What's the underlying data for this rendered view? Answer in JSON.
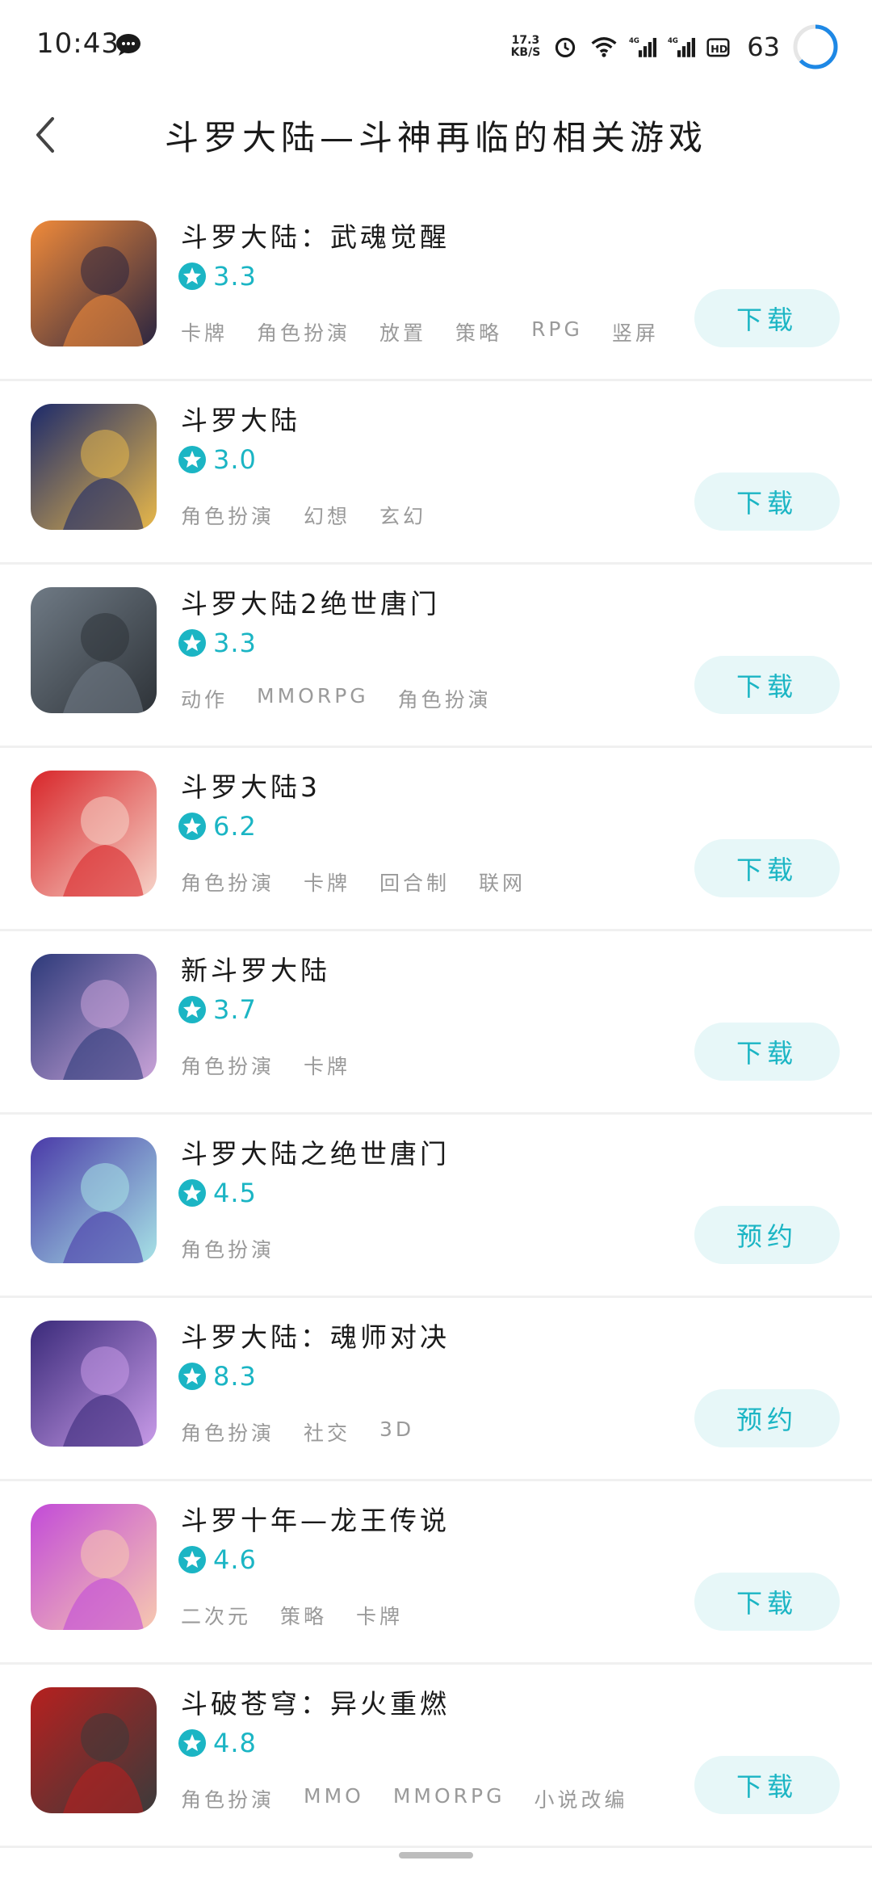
{
  "status_bar": {
    "time": "10:43",
    "net_speed_value": "17.3",
    "net_speed_unit": "KB/S",
    "battery": "63",
    "icons": [
      "chat-bubble-icon",
      "alarm-icon",
      "wifi-icon",
      "signal-4g-icon",
      "signal-4g-icon",
      "hd-icon",
      "battery-ring-icon"
    ]
  },
  "header": {
    "title": "斗罗大陆—斗神再临的相关游戏",
    "back_icon": "chevron-left-icon"
  },
  "accent_color": "#1bb5c4",
  "button_bg_color": "#e7f7f8",
  "games": [
    {
      "name": "斗罗大陆：武魂觉醒",
      "rating": "3.3",
      "tags": [
        "卡牌",
        "角色扮演",
        "放置",
        "策略",
        "RPG",
        "竖屏"
      ],
      "action": "下载",
      "icon_colors": [
        "#f08a3a",
        "#2a2540"
      ]
    },
    {
      "name": "斗罗大陆",
      "rating": "3.0",
      "tags": [
        "角色扮演",
        "幻想",
        "玄幻"
      ],
      "action": "下载",
      "icon_colors": [
        "#1c2a6b",
        "#e8b84a"
      ]
    },
    {
      "name": "斗罗大陆2绝世唐门",
      "rating": "3.3",
      "tags": [
        "动作",
        "MMORPG",
        "角色扮演"
      ],
      "action": "下载",
      "icon_colors": [
        "#6f7a85",
        "#2e3338"
      ]
    },
    {
      "name": "斗罗大陆3",
      "rating": "6.2",
      "tags": [
        "角色扮演",
        "卡牌",
        "回合制",
        "联网"
      ],
      "action": "下载",
      "icon_colors": [
        "#d8262a",
        "#f6d3c8"
      ]
    },
    {
      "name": "新斗罗大陆",
      "rating": "3.7",
      "tags": [
        "角色扮演",
        "卡牌"
      ],
      "action": "下载",
      "icon_colors": [
        "#2d3a7a",
        "#c9a3d8"
      ]
    },
    {
      "name": "斗罗大陆之绝世唐门",
      "rating": "4.5",
      "tags": [
        "角色扮演"
      ],
      "action": "预约",
      "icon_colors": [
        "#4a3aa8",
        "#a7e3e6"
      ]
    },
    {
      "name": "斗罗大陆：魂师对决",
      "rating": "8.3",
      "tags": [
        "角色扮演",
        "社交",
        "3D"
      ],
      "action": "预约",
      "icon_colors": [
        "#3a2a7a",
        "#c89be8"
      ]
    },
    {
      "name": "斗罗十年—龙王传说",
      "rating": "4.6",
      "tags": [
        "二次元",
        "策略",
        "卡牌"
      ],
      "action": "下载",
      "icon_colors": [
        "#c24bd8",
        "#f7c9b0"
      ]
    },
    {
      "name": "斗破苍穹：异火重燃",
      "rating": "4.8",
      "tags": [
        "角色扮演",
        "MMO",
        "MMORPG",
        "小说改编"
      ],
      "action": "下载",
      "icon_colors": [
        "#b6201f",
        "#3b3b3b"
      ]
    }
  ]
}
